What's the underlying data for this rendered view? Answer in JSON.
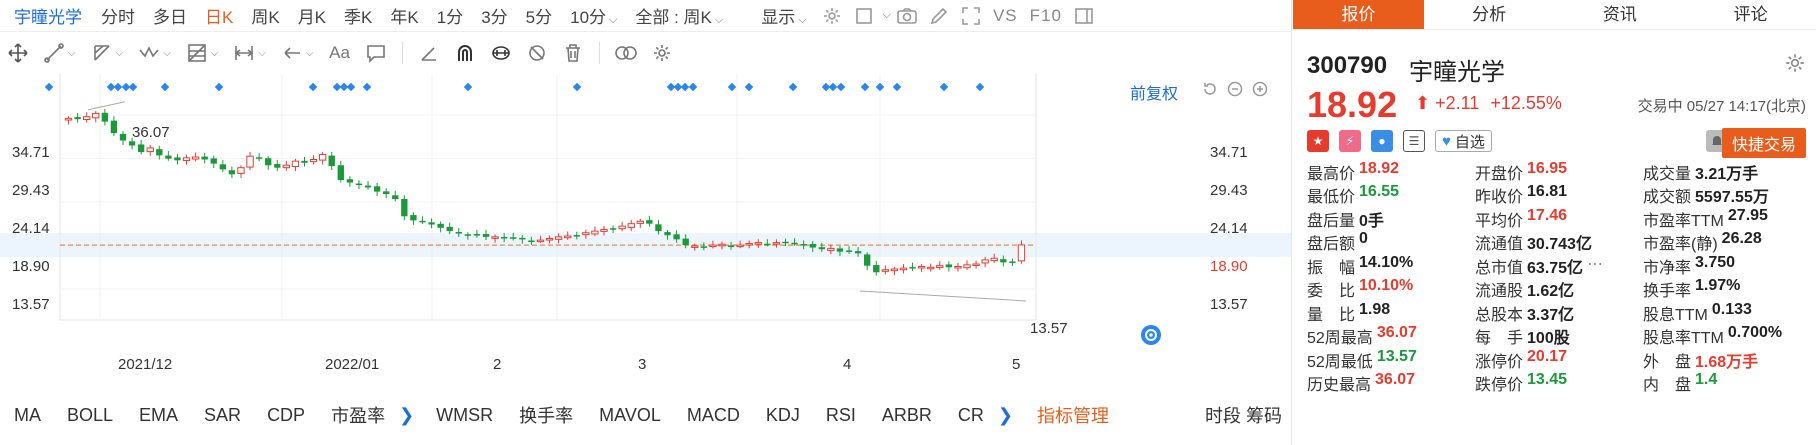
{
  "toolbar": {
    "stock_name": "宇瞳光学",
    "periods": [
      "分时",
      "多日",
      "日K",
      "周K",
      "月K",
      "季K",
      "年K",
      "1分",
      "3分",
      "5分",
      "10分"
    ],
    "active_period": "日K",
    "range_label": "全部 : 周K",
    "display_label": "显示",
    "vs_label": "VS",
    "f10_label": "F10"
  },
  "chart": {
    "adjust_label": "前复权",
    "y_ticks": [
      "34.71",
      "29.43",
      "24.14",
      "18.90",
      "13.57"
    ],
    "x_ticks": [
      "2021/12",
      "2022/01",
      "2",
      "3",
      "4",
      "5"
    ],
    "annotation_high": "36.07",
    "annotation_low": "13.57",
    "current_price_label": "18.90"
  },
  "chart_data": {
    "type": "candlestick",
    "ylim": [
      11.5,
      37.5
    ],
    "y_ticks": [
      34.71,
      29.43,
      24.14,
      18.9,
      13.57
    ],
    "max_label": 36.07,
    "min_label": 13.57,
    "last_price_line": 18.9,
    "x_tick_labels": [
      "2021/12",
      "2022/01",
      "2",
      "3",
      "4",
      "5"
    ],
    "close_series": [
      34.3,
      34.2,
      34.5,
      34.9,
      33.9,
      32.5,
      31.6,
      31.0,
      30.2,
      30.7,
      29.8,
      29.4,
      29.2,
      29.5,
      29.6,
      29.3,
      28.8,
      28.1,
      27.5,
      28.3,
      29.7,
      29.5,
      28.6,
      28.3,
      28.6,
      29.1,
      28.9,
      29.3,
      29.9,
      28.5,
      26.8,
      26.5,
      26.2,
      25.9,
      25.4,
      25.1,
      24.5,
      22.4,
      21.9,
      21.8,
      21.4,
      21.0,
      20.6,
      20.3,
      20.1,
      20.2,
      19.9,
      19.9,
      19.7,
      19.8,
      19.6,
      19.4,
      19.5,
      19.7,
      19.9,
      20.0,
      20.1,
      20.4,
      20.6,
      20.8,
      20.9,
      21.2,
      21.5,
      21.8,
      21.5,
      20.6,
      20.1,
      19.6,
      18.9,
      18.8,
      18.7,
      18.9,
      19.0,
      18.8,
      18.9,
      19.1,
      19.2,
      19.0,
      19.2,
      19.3,
      19.1,
      18.9,
      18.6,
      18.4,
      18.5,
      18.1,
      18.2,
      17.9,
      16.4,
      15.6,
      15.9,
      16.0,
      16.1,
      16.1,
      16.3,
      16.2,
      16.4,
      16.2,
      16.3,
      16.5,
      16.6,
      17.1,
      17.3,
      16.8,
      16.9,
      18.92
    ]
  },
  "indicators": {
    "items": [
      "MA",
      "BOLL",
      "EMA",
      "SAR",
      "CDP",
      "市盈率",
      "WMSR",
      "换手率",
      "MAVOL",
      "MACD",
      "KDJ",
      "RSI",
      "ARBR",
      "CR"
    ],
    "manage_label": "指标管理",
    "right_label": "时段 筹码"
  },
  "panel": {
    "tabs": [
      "报价",
      "分析",
      "资讯",
      "评论"
    ],
    "active_tab": "报价",
    "code": "300790",
    "name": "宇瞳光学",
    "price": "18.92",
    "change": "+2.11",
    "change_pct": "+12.55%",
    "status": "交易中 05/27 14:17(北京)",
    "watch_label": "自选",
    "quick_trade_label": "快捷交易",
    "stats": [
      [
        {
          "k": "最高价",
          "v": "18.92",
          "c": "red"
        },
        {
          "k": "开盘价",
          "v": "16.95",
          "c": "red"
        },
        {
          "k": "成交量",
          "v": "3.21万手",
          "c": "dark"
        }
      ],
      [
        {
          "k": "最低价",
          "v": "16.55",
          "c": "green"
        },
        {
          "k": "昨收价",
          "v": "16.81",
          "c": "dark"
        },
        {
          "k": "成交额",
          "v": "5597.55万",
          "c": "dark"
        }
      ],
      [
        {
          "k": "盘后量",
          "v": "0手",
          "c": "dark"
        },
        {
          "k": "平均价",
          "v": "17.46",
          "c": "red"
        },
        {
          "k": "市盈率TTM",
          "v": "27.95",
          "c": "dark"
        }
      ],
      [
        {
          "k": "盘后额",
          "v": "0",
          "c": "dark"
        },
        {
          "k": "流通值",
          "v": "30.743亿",
          "c": "dark"
        },
        {
          "k": "市盈率(静)",
          "v": "26.28",
          "c": "dark"
        }
      ],
      [
        {
          "k": "振　幅",
          "v": "14.10%",
          "c": "dark"
        },
        {
          "k": "总市值",
          "v": "63.75亿",
          "c": "dark"
        },
        {
          "k": "市净率",
          "v": "3.750",
          "c": "dark"
        }
      ],
      [
        {
          "k": "委　比",
          "v": "10.10%",
          "c": "red"
        },
        {
          "k": "流通股",
          "v": "1.62亿",
          "c": "dark"
        },
        {
          "k": "换手率",
          "v": "1.97%",
          "c": "dark"
        }
      ],
      [
        {
          "k": "量　比",
          "v": "1.98",
          "c": "dark"
        },
        {
          "k": "总股本",
          "v": "3.37亿",
          "c": "dark"
        },
        {
          "k": "股息TTM",
          "v": "0.133",
          "c": "dark"
        }
      ],
      [
        {
          "k": "52周最高",
          "v": "36.07",
          "c": "red"
        },
        {
          "k": "每　手",
          "v": "100股",
          "c": "dark"
        },
        {
          "k": "股息率TTM",
          "v": "0.700%",
          "c": "dark"
        }
      ],
      [
        {
          "k": "52周最低",
          "v": "13.57",
          "c": "green"
        },
        {
          "k": "涨停价",
          "v": "20.17",
          "c": "red"
        },
        {
          "k": "外　盘",
          "v": "1.68万手",
          "c": "red"
        }
      ],
      [
        {
          "k": "历史最高",
          "v": "36.07",
          "c": "red"
        },
        {
          "k": "跌停价",
          "v": "13.45",
          "c": "green"
        },
        {
          "k": "内　盘",
          "v": "1.4",
          "c": "green"
        }
      ]
    ]
  },
  "colors": {
    "accent": "#e85d1b",
    "up": "#e63c2e",
    "down": "#1a9a3a",
    "link": "#1a6ed8"
  }
}
